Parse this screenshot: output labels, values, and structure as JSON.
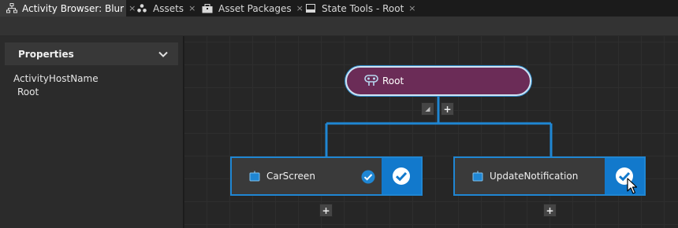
{
  "tabs": [
    {
      "label": "Activity Browser: Blur",
      "icon": "hierarchy-icon",
      "active": true
    },
    {
      "label": "Assets",
      "icon": "assets-icon",
      "active": false
    },
    {
      "label": "Asset Packages",
      "icon": "package-icon",
      "active": false
    },
    {
      "label": "State Tools - Root",
      "icon": "window-icon",
      "active": false
    }
  ],
  "close_glyph": "×",
  "properties": {
    "title": "Properties",
    "field_label": "ActivityHostName",
    "field_value": "Root"
  },
  "graph": {
    "root": {
      "label": "Root",
      "icon": "activity-node-icon"
    },
    "root_collapse_symbol": "◢",
    "add_symbol": "+",
    "children": [
      {
        "label": "CarScreen",
        "icon": "screen-icon",
        "checked": true
      },
      {
        "label": "UpdateNotification",
        "icon": "screen-icon",
        "checked": true
      }
    ]
  },
  "colors": {
    "accent": "#1f86d3",
    "root_fill": "#6b2c57",
    "check_panel": "#1279cc"
  }
}
